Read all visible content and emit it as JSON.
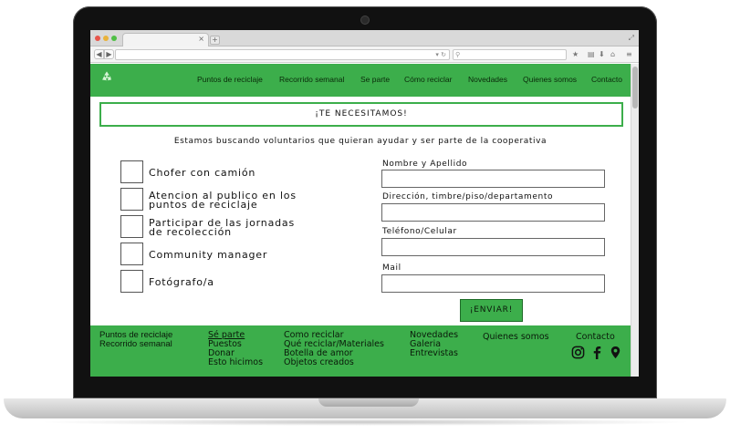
{
  "browser": {
    "new_tab_symbol": "+",
    "tab_close_symbol": "×",
    "back_symbol": "◀",
    "forward_symbol": "▶"
  },
  "header": {
    "nav": [
      "Puntos de reciclaje",
      "Recorrido semanal",
      "Se parte",
      "Cómo reciclar",
      "Novedades",
      "Quienes somos",
      "Contacto"
    ]
  },
  "main": {
    "banner": "¡TE NECESITAMOS!",
    "intro": "Estamos buscando voluntarios que quieran ayudar y ser parte de la cooperativa",
    "options": [
      {
        "line1": "Chofer con camión",
        "line2": ""
      },
      {
        "line1": "Atencion al publico en los",
        "line2": "puntos de reciclaje"
      },
      {
        "line1": "Participar de las jornadas",
        "line2": "de recolección"
      },
      {
        "line1": "Community manager",
        "line2": ""
      },
      {
        "line1": "Fotógrafo/a",
        "line2": ""
      }
    ],
    "form": {
      "name_label": "Nombre y Apellido",
      "address_label": "Dirección, timbre/piso/departamento",
      "phone_label": "Teléfono/Celular",
      "mail_label": "Mail",
      "submit": "¡ENVIAR!"
    }
  },
  "footer": {
    "col1": [
      "Puntos de reciclaje",
      "Recorrido semanal"
    ],
    "col2": [
      "Sé parte",
      "Puestos",
      "Donar",
      "Esto hicimos"
    ],
    "col3": [
      "Como reciclar",
      "Qué reciclar/Materiales",
      "Botella de amor",
      "Objetos creados"
    ],
    "col4": [
      "Novedades",
      "Galeria",
      "Entrevistas"
    ],
    "col5": [
      "Quienes somos"
    ],
    "col6": [
      "Contacto"
    ]
  },
  "colors": {
    "brand_green": "#3cae4b",
    "footer_text": "#0a1a0a"
  },
  "icons": [
    "recycle-logo-icon",
    "instagram-icon",
    "facebook-icon",
    "location-pin-icon"
  ]
}
